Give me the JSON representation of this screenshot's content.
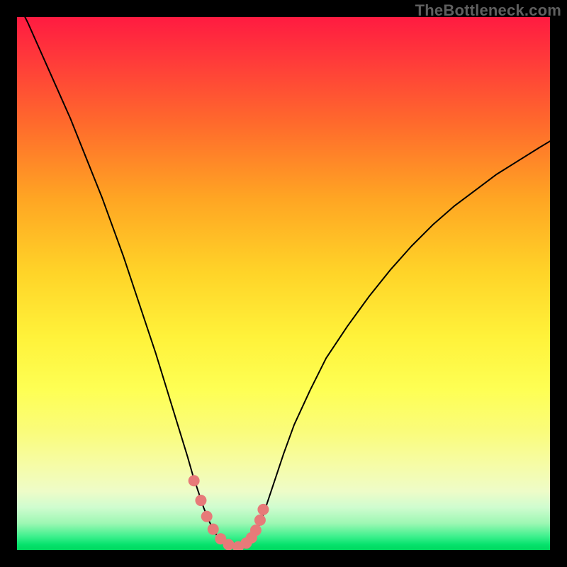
{
  "watermark": "TheBottleneck.com",
  "colors": {
    "curve": "#000000",
    "marker": "#e77a79",
    "frame": "#000000"
  },
  "chart_data": {
    "type": "line",
    "title": "",
    "xlabel": "",
    "ylabel": "",
    "xlim": [
      0,
      100
    ],
    "ylim": [
      0,
      100
    ],
    "grid": false,
    "x": [
      0,
      2,
      4,
      6,
      8,
      10,
      12,
      14,
      16,
      18,
      20,
      22,
      24,
      26,
      28,
      30,
      32,
      33,
      34,
      35,
      36,
      37,
      38,
      39,
      40,
      41,
      42,
      43,
      44,
      45,
      46,
      48,
      50,
      52,
      55,
      58,
      62,
      66,
      70,
      74,
      78,
      82,
      86,
      90,
      94,
      98,
      100
    ],
    "values": [
      103,
      99,
      94.5,
      90,
      85.5,
      81,
      76,
      71,
      66,
      60.5,
      55,
      49,
      43,
      37,
      30.5,
      24,
      17.5,
      14,
      11,
      8,
      5.5,
      3.5,
      2,
      1,
      0.5,
      0.5,
      0.7,
      1.2,
      2.2,
      3.7,
      6,
      12,
      18,
      23.5,
      30,
      36,
      42,
      47.5,
      52.5,
      57,
      61,
      64.5,
      67.5,
      70.5,
      73,
      75.5,
      76.7
    ],
    "markers": {
      "x": [
        33.2,
        34.5,
        35.6,
        36.8,
        38.2,
        39.7,
        41.5,
        43.0,
        44.0,
        44.8,
        45.6,
        46.2
      ],
      "values": [
        13.0,
        9.3,
        6.3,
        3.9,
        2.1,
        1.0,
        0.6,
        1.3,
        2.3,
        3.7,
        5.6,
        7.6
      ]
    }
  }
}
